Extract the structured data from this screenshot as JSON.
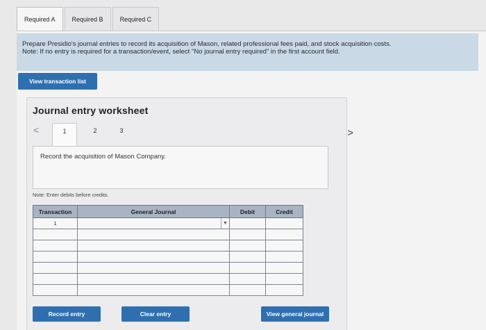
{
  "tabs": [
    {
      "label": "Required A",
      "active": true
    },
    {
      "label": "Required B",
      "active": false
    },
    {
      "label": "Required C",
      "active": false
    }
  ],
  "instructions": {
    "line1": "Prepare Presidio's journal entries to record its acquisition of Mason, related professional fees paid, and stock acquisition costs.",
    "line2": "Note: If no entry is required for a transaction/event, select \"No journal entry required\" in the first account field."
  },
  "buttons": {
    "view_transaction_list": "View transaction list",
    "record_entry": "Record entry",
    "clear_entry": "Clear entry",
    "view_general_journal": "View general journal"
  },
  "worksheet": {
    "title": "Journal entry worksheet",
    "nav_prev": "<",
    "nav_next": ">",
    "pages": [
      "1",
      "2",
      "3"
    ],
    "active_page": "1",
    "record_text": "Record the acquisition of Mason Company.",
    "note": "Note: Enter debits before credits."
  },
  "journal": {
    "headers": {
      "transaction": "Transaction",
      "general_journal": "General Journal",
      "debit": "Debit",
      "credit": "Credit"
    },
    "first_row_transaction": "1"
  },
  "colors": {
    "primary_button": "#2f6fb0",
    "instructions_bg": "#c9d9e6",
    "table_header": "#a9b4c3"
  }
}
